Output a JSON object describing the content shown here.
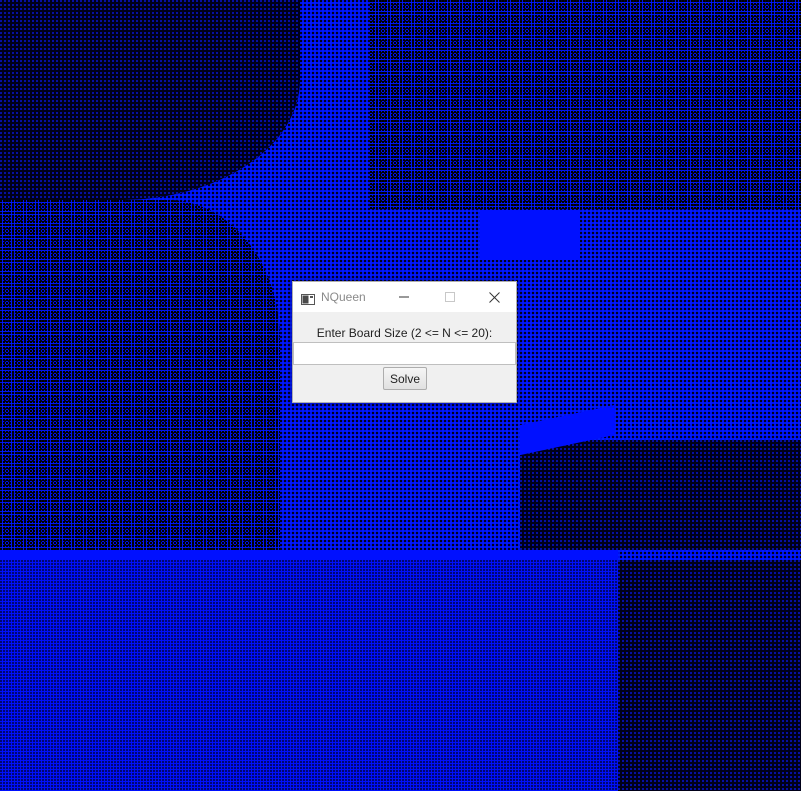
{
  "window": {
    "title": "NQueen",
    "controls": {
      "minimize_icon": "minimize-icon",
      "maximize_icon": "maximize-icon",
      "close_icon": "close-icon"
    }
  },
  "form": {
    "prompt": "Enter Board Size (2 <= N <= 20):",
    "input_value": "",
    "input_placeholder": "",
    "solve_label": "Solve"
  },
  "colors": {
    "desktop_blue": "#0010ff",
    "window_bg": "#f0f0f0",
    "titlebar_bg": "#ffffff"
  }
}
